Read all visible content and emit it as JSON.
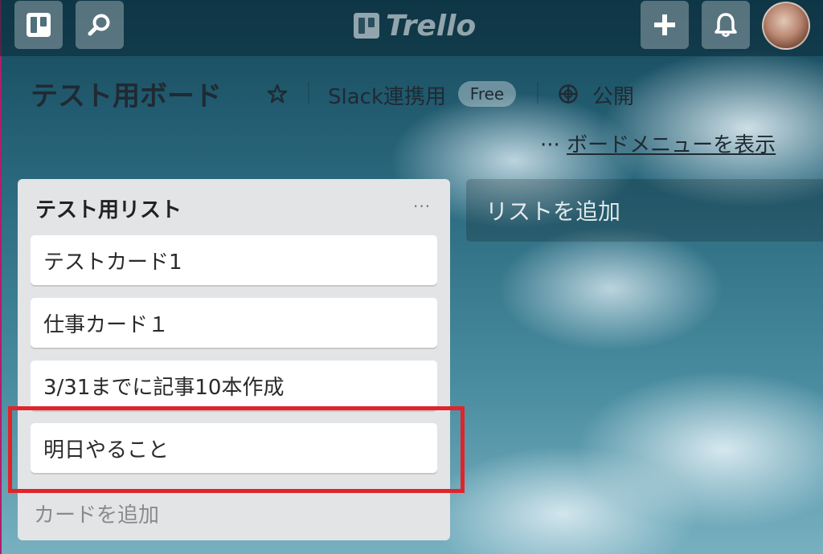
{
  "app": {
    "logo_text": "Trello"
  },
  "header": {
    "board_title": "テスト用ボード",
    "star_icon": "star-icon",
    "team_name": "Slack連携用",
    "plan_badge": "Free",
    "visibility_label": "公開",
    "menu_dots": "···",
    "board_menu_label": "ボードメニューを表示"
  },
  "list": {
    "title": "テスト用リスト",
    "menu_dots": "···",
    "cards": [
      {
        "title": "テストカード1"
      },
      {
        "title": "仕事カード１"
      },
      {
        "title": "3/31までに記事10本作成"
      },
      {
        "title": "明日やること"
      }
    ],
    "add_card_label": "カードを追加"
  },
  "add_list_label": "リストを追加",
  "colors": {
    "highlight": "#e0242a",
    "list_bg": "#e2e4e6"
  }
}
